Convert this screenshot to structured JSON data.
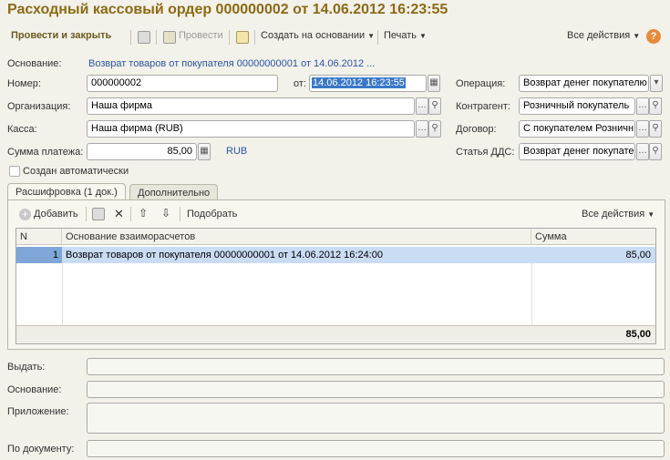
{
  "window": {
    "title": "Расходный кассовый ордер 000000002 от 14.06.2012 16:23:55"
  },
  "toolbar": {
    "post_close_label": "Провести и закрыть",
    "post_label": "Провести",
    "create_based_label": "Создать на основании",
    "print_label": "Печать",
    "all_actions_label": "Все действия",
    "help_label": "?"
  },
  "form": {
    "basis_label": "Основание:",
    "basis_link": "Возврат товаров от покупателя 00000000001 от 14.06.2012 ...",
    "number_label": "Номер:",
    "number_value": "000000002",
    "date_label": "от:",
    "date_value": "14.06.2012 16:23:55",
    "operation_label": "Операция:",
    "operation_value": "Возврат денег покупателю",
    "org_label": "Организация:",
    "org_value": "Наша фирма",
    "counterparty_label": "Контрагент:",
    "counterparty_value": "Розничный покупатель",
    "cashbox_label": "Касса:",
    "cashbox_value": "Наша фирма (RUB)",
    "contract_label": "Договор:",
    "contract_value": "С покупателем Розничн",
    "amount_label": "Сумма платежа:",
    "amount_value": "85,00",
    "currency": "RUB",
    "dds_label": "Статья ДДС:",
    "dds_value": "Возврат денег покупате",
    "auto_created_label": "Создан автоматически"
  },
  "tabs": [
    {
      "label": "Расшифровка (1 док.)"
    },
    {
      "label": "Дополнительно"
    }
  ],
  "table_toolbar": {
    "add_label": "Добавить",
    "pick_label": "Подобрать",
    "all_actions_label": "Все действия"
  },
  "table": {
    "columns": [
      "N",
      "Основание взаиморасчетов",
      "Сумма"
    ],
    "rows": [
      {
        "n": "1",
        "basis": "Возврат товаров от покупателя 00000000001 от 14.06.2012 16:24:00",
        "sum": "85,00"
      }
    ],
    "total": "85,00"
  },
  "bottom": {
    "issue_label": "Выдать:",
    "issue_value": "",
    "basis_label": "Основание:",
    "basis_value": "",
    "attachment_label": "Приложение:",
    "attachment_value": "",
    "by_doc_label": "По документу:",
    "by_doc_value": ""
  },
  "colors": {
    "title": "#8c6a14",
    "link": "#2a55a6",
    "selection": "#3a78c8",
    "row_selected": "#c9dcf4"
  }
}
